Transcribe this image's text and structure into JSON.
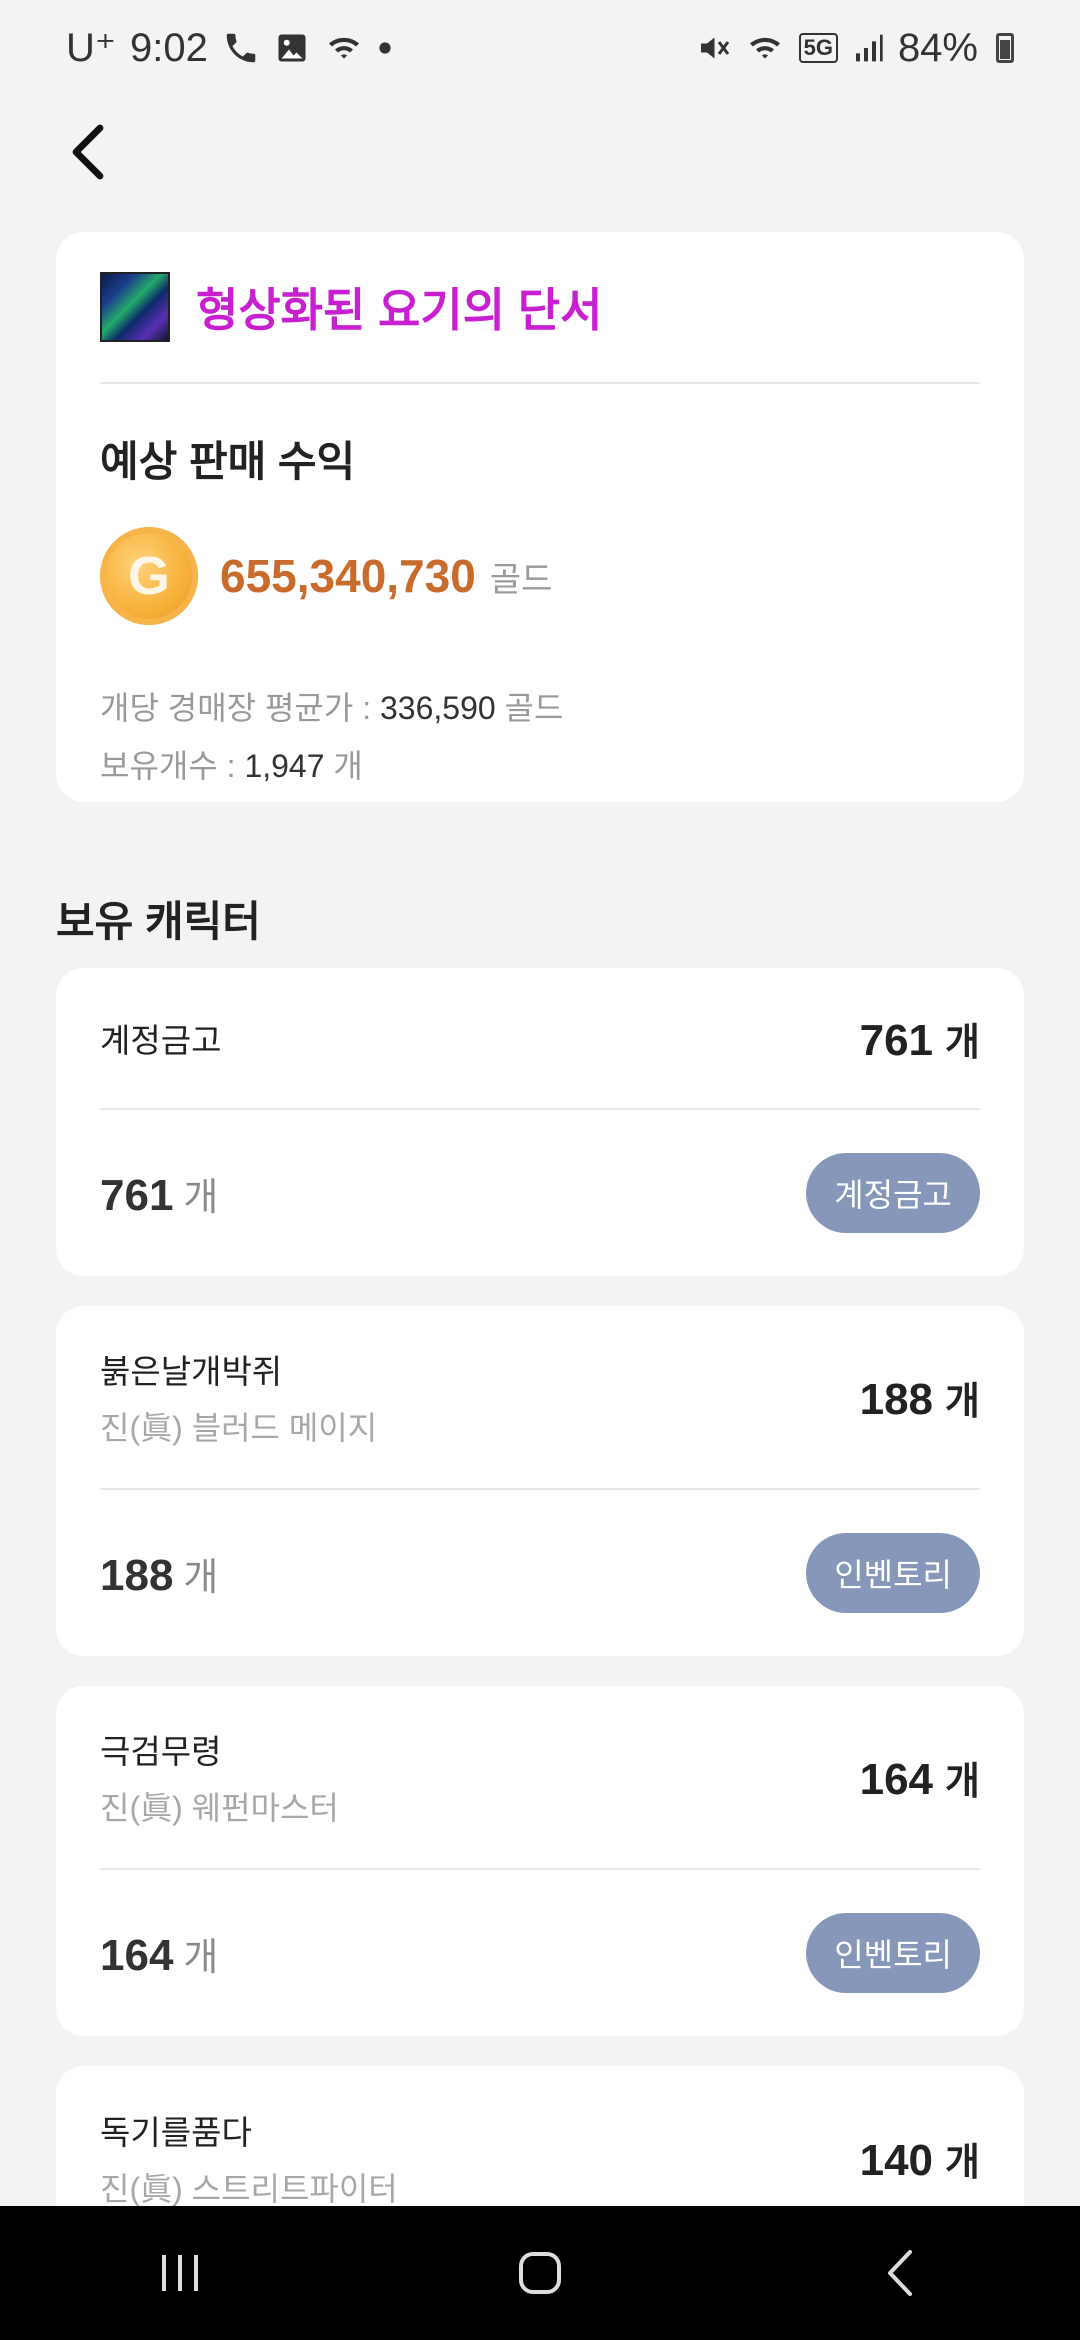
{
  "status_bar": {
    "carrier": "U⁺",
    "time": "9:02",
    "battery": "84%",
    "network": "5G"
  },
  "item": {
    "name": "형상화된 요기의 단서",
    "revenue_label": "예상 판매 수익",
    "revenue_value": "655,340,730",
    "currency": "골드",
    "coin_letter": "G",
    "avg_price_label": "개당 경매장 평균가 : ",
    "avg_price_value": "336,590",
    "avg_price_unit": " 골드",
    "owned_count_label": "보유개수 : ",
    "owned_count_value": "1,947",
    "owned_count_unit": " 개"
  },
  "owned_section_title": "보유 캐릭터",
  "characters": [
    {
      "name": "계정금고",
      "class": "",
      "total": "761",
      "loc_count": "761",
      "unit": "개",
      "location": "계정금고"
    },
    {
      "name": "붉은날개박쥐",
      "class": "진(眞) 블러드 메이지",
      "total": "188",
      "loc_count": "188",
      "unit": "개",
      "location": "인벤토리"
    },
    {
      "name": "극검무령",
      "class": "진(眞) 웨펀마스터",
      "total": "164",
      "loc_count": "164",
      "unit": "개",
      "location": "인벤토리"
    },
    {
      "name": "독기를품다",
      "class": "진(眞) 스트리트파이터",
      "total": "140",
      "unit": "개"
    }
  ],
  "colors": {
    "item_name": "#c81fd0",
    "revenue": "#c96b2c",
    "location_button": "#8797b9",
    "background": "#f2f3f5"
  }
}
